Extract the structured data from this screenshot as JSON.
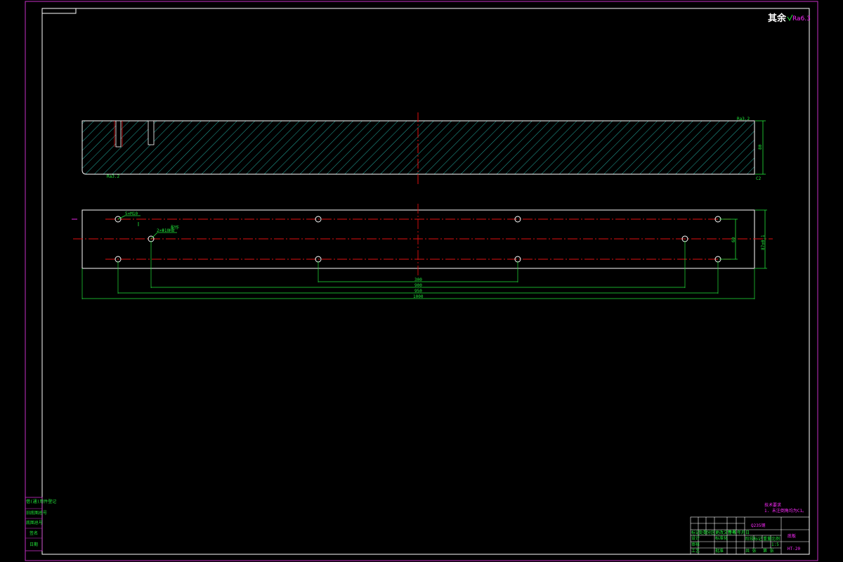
{
  "colors": {
    "background": "#000000",
    "outline": "#ffffff",
    "border": "#c62fc6",
    "centerline": "#e01010",
    "dimension": "#22e63a",
    "hatch": "#2bd6c8",
    "annotation": "#ff2bff"
  },
  "surface_finish": {
    "prefix": "其余",
    "symbol": "Ra6.3"
  },
  "front_view": {
    "top_right_finish": "Ra3.2",
    "bottom_left_finish": "Ra3.2",
    "height_dim": "80",
    "chamfer": "C2"
  },
  "top_view": {
    "hole_callout_1": "5×M10",
    "hole_callout_2": "2×Φ10H8",
    "hole_callout_2_note": "配作",
    "dim_spacing_small": "300",
    "dim_spacing_mid": "900",
    "dim_spacing_large": "950",
    "dim_overall": "1000",
    "dim_holes_vertical": "60",
    "dim_width": "87±0.1"
  },
  "technical_requirements": {
    "heading": "技术要求",
    "line1": "1. 未注倒角均为C1。"
  },
  "title_block": {
    "material": "Q235钢",
    "part_name": "底板",
    "drawing_no": "HT-20",
    "cells": [
      "标记",
      "处数",
      "分区",
      "更改文件号",
      "签名",
      "年月日",
      "设计",
      "标准化",
      "阶段标记",
      "重量",
      "比例",
      "审核",
      "工艺",
      "批准",
      "共 张",
      "第 张",
      "1:5"
    ]
  },
  "left_stamp": {
    "rows": [
      "借(通)用件登记",
      "旧底图总号",
      "底图总号",
      "签名",
      "日期"
    ]
  }
}
